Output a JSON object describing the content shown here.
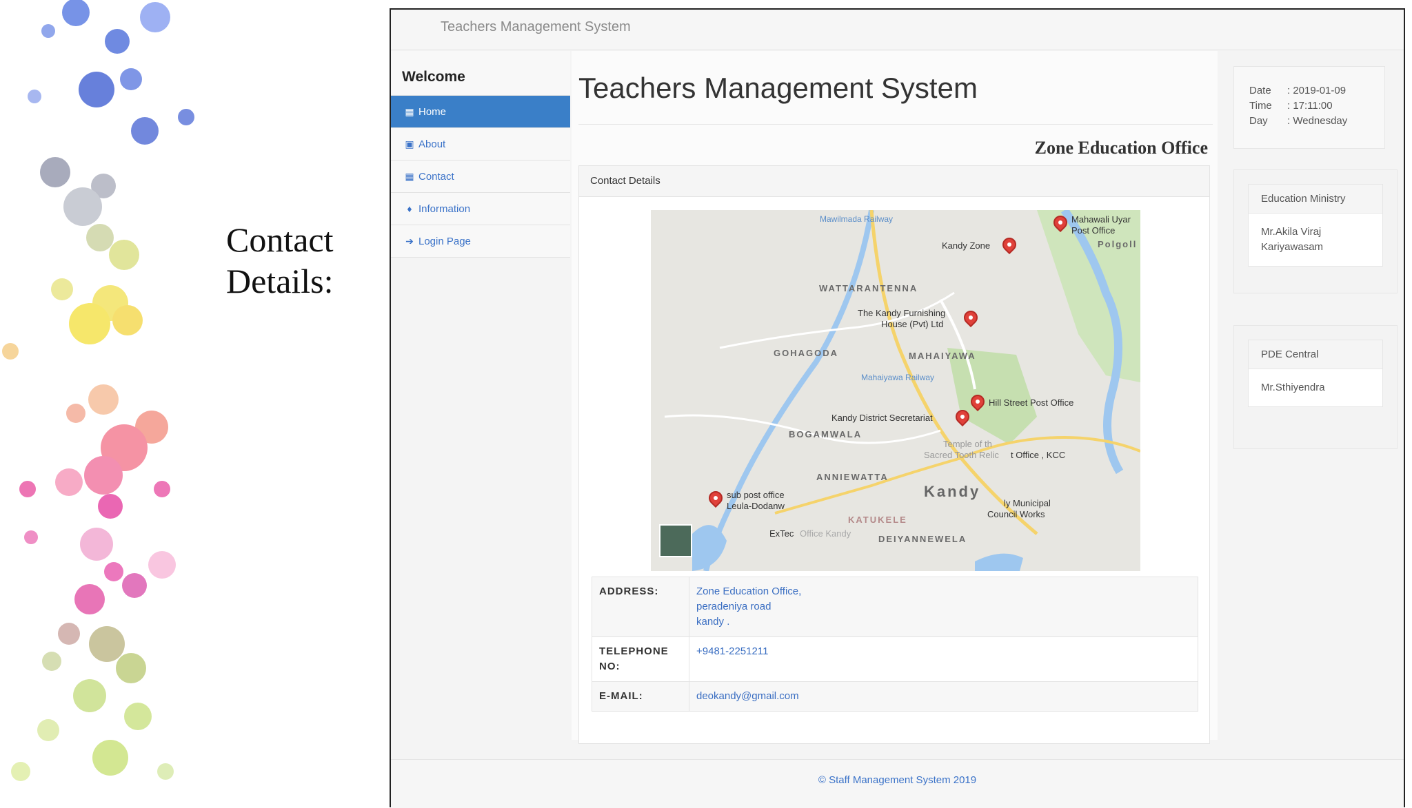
{
  "slide": {
    "caption_line1": "Contact",
    "caption_line2": "Details:"
  },
  "app": {
    "brand": "Teachers Management System"
  },
  "sidebar": {
    "welcome": "Welcome",
    "items": [
      {
        "label": "Home",
        "icon": "table-icon",
        "active": true
      },
      {
        "label": "About",
        "icon": "floppy-icon",
        "active": false
      },
      {
        "label": "Contact",
        "icon": "table-icon",
        "active": false
      },
      {
        "label": "Information",
        "icon": "map-marker-icon",
        "active": false
      },
      {
        "label": "Login Page",
        "icon": "login-icon",
        "active": false
      }
    ]
  },
  "main": {
    "title": "Teachers Management System",
    "office": "Zone Education Office",
    "panel_heading": "Contact Details"
  },
  "map": {
    "labels": {
      "mawilmada": "Mawilmada Railway",
      "mahawali": "Mahawali Uyar",
      "mahawali2": "Post Office",
      "polgolla": "Polgoll",
      "kandy_zone": "Kandy Zone",
      "wattarantenna": "WATTARANTENNA",
      "furnishing": "The Kandy Furnishing",
      "furnishing2": "House (Pvt) Ltd",
      "gohagoda": "GOHAGODA",
      "mahaiyawa": "MAHAIYAWA",
      "mahaiyawa_rail": "Mahaiyawa Railway",
      "hill_street": "Hill Street Post Office",
      "district_sec": "Kandy District Secretariat",
      "bogambara": "BOGAMWALA",
      "temple": "Temple of th",
      "temple2": "Sacred Tooth Relic",
      "post_office_kcc": "t Office , KCC",
      "anniewatta": "ANNIEWATTA",
      "kandy": "Kandy",
      "sub_post": "sub post office",
      "sub_post2": "Leula-Dodanw",
      "municipal": "ly Municipal",
      "municipal2": "Council Works",
      "katukele": "KATUKELE",
      "extec": "ExTec",
      "extec2": "Office Kandy",
      "deiyannewela": "DEIYANNEWELA"
    }
  },
  "contact": {
    "address_label": "ADDRESS:",
    "address_line1": "Zone Education Office,",
    "address_line2": "peradeniya road",
    "address_line3": "kandy .",
    "telephone_label": "TELEPHONE NO:",
    "telephone": "+9481-2251211",
    "email_label": "E-MAIL:",
    "email": "deokandy@gmail.com"
  },
  "datebox": {
    "date_label": "Date",
    "date": ": 2019-01-09",
    "time_label": "Time",
    "time": ": 17:11:00",
    "day_label": "Day",
    "day": ": Wednesday"
  },
  "ministry": {
    "heading": "Education Ministry",
    "line1": "Mr.Akila Viraj",
    "line2": "Kariyawasam"
  },
  "pde": {
    "heading": "PDE Central",
    "name": "Mr.Sthiyendra"
  },
  "footer": {
    "text": "© Staff Management System  2019"
  }
}
